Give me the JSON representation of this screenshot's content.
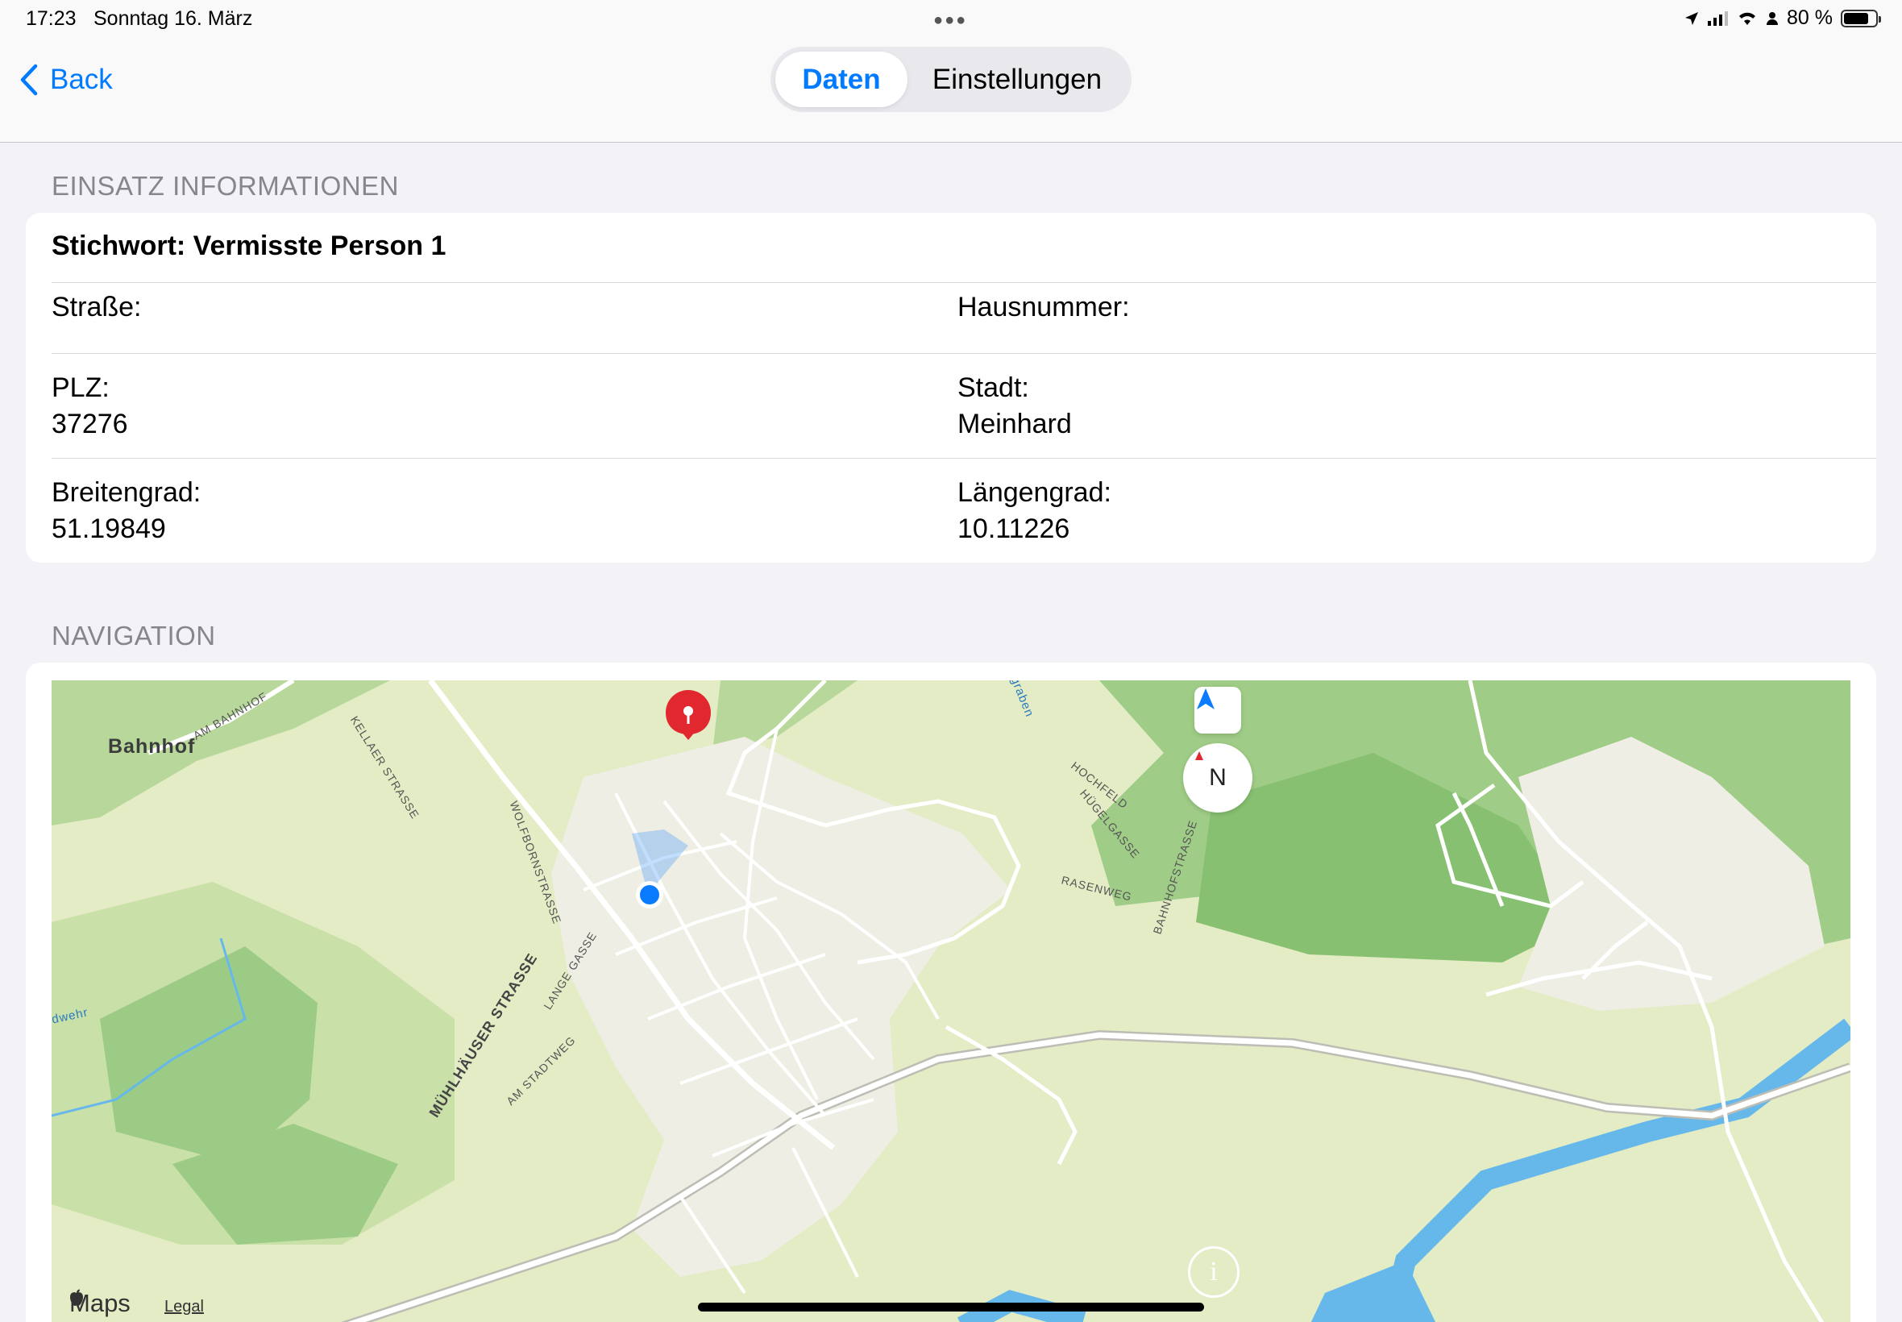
{
  "status_bar": {
    "time": "17:23",
    "date": "Sonntag 16. März",
    "battery": "80 %",
    "battery_fraction": 0.8
  },
  "nav": {
    "back_label": "Back",
    "segments": [
      "Daten",
      "Einstellungen"
    ],
    "selected": "Daten"
  },
  "einsatz": {
    "header": "EINSATZ INFORMATIONEN",
    "title": "Stichwort: Vermisste Person 1",
    "strasse_label": "Straße:",
    "strasse_value": "",
    "hausnummer_label": "Hausnummer:",
    "hausnummer_value": "",
    "plz_label": "PLZ:",
    "plz_value": "37276",
    "stadt_label": "Stadt:",
    "stadt_value": "Meinhard",
    "breitengrad_label": "Breitengrad:",
    "breitengrad_value": "51.19849",
    "laengengrad_label": "Längengrad:",
    "laengengrad_value": "10.11226"
  },
  "navigation": {
    "header": "NAVIGATION",
    "map": {
      "place_labels": {
        "bahnhof": "Bahnhof",
        "am_bahnhof": "AM BAHNHOF",
        "kellaer": "KELLAER STRASSE",
        "wolfborn": "WOLFBORNSTRASSE",
        "lange_gasse": "LANGE GASSE",
        "muehlhaeuser": "MÜHLHÄUSER STRASSE",
        "am_stadtweg": "AM STADTWEG",
        "hochfeld": "HOCHFELD",
        "huegelgasse": "HÜGELGASSE",
        "rasenweg": "RASENWEG",
        "bahnhofstrasse": "BAHNHOFSTRASSE",
        "graben": "graben",
        "wehr": "dwehr"
      },
      "compass_label": "N",
      "attribution": "Maps",
      "legal": "Legal"
    }
  },
  "colors": {
    "accent": "#007aff",
    "pin": "#e0282e",
    "location": "#0a7aff"
  }
}
